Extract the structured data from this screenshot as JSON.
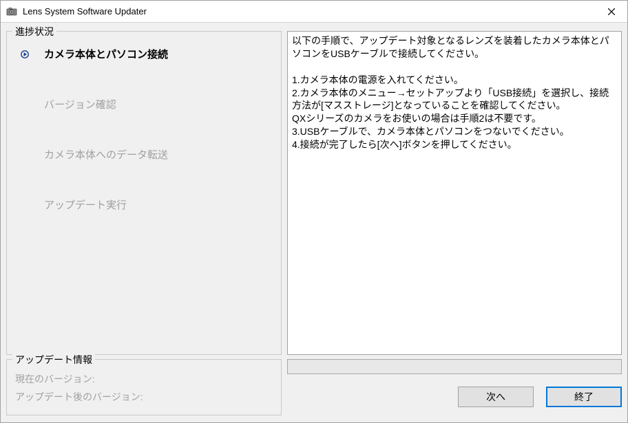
{
  "window": {
    "title": "Lens System Software Updater"
  },
  "progress": {
    "heading": "進捗状況",
    "steps": [
      {
        "label": "カメラ本体とパソコン接続",
        "active": true
      },
      {
        "label": "バージョン確認",
        "active": false
      },
      {
        "label": "カメラ本体へのデータ転送",
        "active": false
      },
      {
        "label": "アップデート実行",
        "active": false
      }
    ]
  },
  "instructions": "以下の手順で、アップデート対象となるレンズを装着したカメラ本体とパソコンをUSBケーブルで接続してください。\n\n1.カメラ本体の電源を入れてください。\n2.カメラ本体のメニュー→セットアップより「USB接続」を選択し、接続方法が[マスストレージ]となっていることを確認してください。\nQXシリーズのカメラをお使いの場合は手順2は不要です。\n3.USBケーブルで、カメラ本体とパソコンをつないでください。\n4.接続が完了したら[次へ]ボタンを押してください。",
  "update_info": {
    "heading": "アップデート情報",
    "current_label": "現在のバージョン:",
    "current_value": "",
    "after_label": "アップデート後のバージョン:",
    "after_value": ""
  },
  "buttons": {
    "next": "次へ",
    "exit": "終了"
  }
}
